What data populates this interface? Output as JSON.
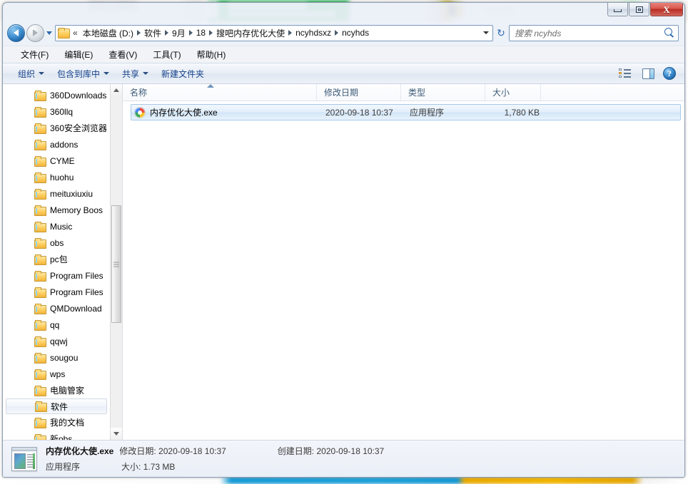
{
  "window": {
    "controls": {
      "minimize": "",
      "maximize": "",
      "close": "X"
    }
  },
  "addressbar": {
    "back_title": "后退",
    "forward_title": "前进",
    "history_caret": "▼",
    "overflow": "«",
    "crumbs": [
      "本地磁盘 (D:)",
      "软件",
      "9月",
      "18",
      "搜吧内存优化大使",
      "ncyhdsxz",
      "ncyhds"
    ],
    "refresh": "↻"
  },
  "search": {
    "placeholder": "搜索 ncyhds"
  },
  "menubar": {
    "items": [
      {
        "text": "文件(F)"
      },
      {
        "text": "编辑(E)"
      },
      {
        "text": "查看(V)"
      },
      {
        "text": "工具(T)"
      },
      {
        "text": "帮助(H)"
      }
    ]
  },
  "commandbar": {
    "organize": "组织",
    "include_in_library": "包含到库中",
    "share": "共享",
    "new_folder": "新建文件夹",
    "view_icon": "view-mode-icon",
    "preview_icon": "preview-pane-icon",
    "help_icon": "?"
  },
  "sidebar": {
    "items": [
      {
        "label": "360Downloads",
        "selected": false
      },
      {
        "label": "360llq",
        "selected": false
      },
      {
        "label": "360安全浏览器",
        "selected": false
      },
      {
        "label": "addons",
        "selected": false
      },
      {
        "label": "CYME",
        "selected": false
      },
      {
        "label": "huohu",
        "selected": false
      },
      {
        "label": "meituxiuxiu",
        "selected": false
      },
      {
        "label": "Memory Boos",
        "selected": false
      },
      {
        "label": "Music",
        "selected": false
      },
      {
        "label": "obs",
        "selected": false
      },
      {
        "label": "pc包",
        "selected": false
      },
      {
        "label": "Program Files",
        "selected": false
      },
      {
        "label": "Program Files",
        "selected": false
      },
      {
        "label": "QMDownload",
        "selected": false
      },
      {
        "label": "qq",
        "selected": false
      },
      {
        "label": "qqwj",
        "selected": false
      },
      {
        "label": "sougou",
        "selected": false
      },
      {
        "label": "wps",
        "selected": false
      },
      {
        "label": "电脑管家",
        "selected": false
      },
      {
        "label": "软件",
        "selected": true
      },
      {
        "label": "我的文档",
        "selected": false
      },
      {
        "label": "新obs",
        "selected": false
      }
    ]
  },
  "filelist": {
    "columns": [
      "名称",
      "修改日期",
      "类型",
      "大小"
    ],
    "sorted_by": "名称",
    "rows": [
      {
        "name": "内存优化大使.exe",
        "modified": "2020-09-18 10:37",
        "type": "应用程序",
        "size": "1,780 KB",
        "selected": true,
        "icon": "app-exe-icon"
      }
    ]
  },
  "statusbar": {
    "file_name": "内存优化大使.exe",
    "modified_label": "修改日期:",
    "modified_value": "2020-09-18 10:37",
    "created_label": "创建日期:",
    "created_value": "2020-09-18 10:37",
    "type_value": "应用程序",
    "size_label": "大小:",
    "size_value": "1.73 MB"
  }
}
